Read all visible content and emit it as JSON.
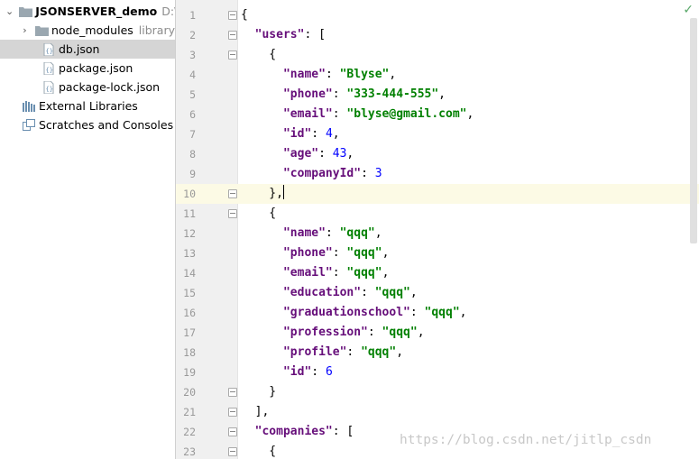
{
  "project_tree": {
    "root": {
      "name": "JSONSERVER_demo",
      "path": "D:\\E"
    },
    "node_modules": {
      "name": "node_modules",
      "tag": "library"
    },
    "files": [
      "db.json",
      "package.json",
      "package-lock.json"
    ],
    "external_libraries": "External Libraries",
    "scratches": "Scratches and Consoles"
  },
  "editor": {
    "status": "ok",
    "lines": [
      [
        {
          "t": "p",
          "v": "{"
        }
      ],
      [
        {
          "t": "p",
          "v": "  "
        },
        {
          "t": "k",
          "v": "\"users\""
        },
        {
          "t": "p",
          "v": ": ["
        }
      ],
      [
        {
          "t": "p",
          "v": "    {"
        }
      ],
      [
        {
          "t": "p",
          "v": "      "
        },
        {
          "t": "k",
          "v": "\"name\""
        },
        {
          "t": "p",
          "v": ": "
        },
        {
          "t": "s",
          "v": "\"Blyse\""
        },
        {
          "t": "p",
          "v": ","
        }
      ],
      [
        {
          "t": "p",
          "v": "      "
        },
        {
          "t": "k",
          "v": "\"phone\""
        },
        {
          "t": "p",
          "v": ": "
        },
        {
          "t": "s",
          "v": "\"333-444-555\""
        },
        {
          "t": "p",
          "v": ","
        }
      ],
      [
        {
          "t": "p",
          "v": "      "
        },
        {
          "t": "k",
          "v": "\"email\""
        },
        {
          "t": "p",
          "v": ": "
        },
        {
          "t": "s",
          "v": "\"blyse@gmail.com\""
        },
        {
          "t": "p",
          "v": ","
        }
      ],
      [
        {
          "t": "p",
          "v": "      "
        },
        {
          "t": "k",
          "v": "\"id\""
        },
        {
          "t": "p",
          "v": ": "
        },
        {
          "t": "n",
          "v": "4"
        },
        {
          "t": "p",
          "v": ","
        }
      ],
      [
        {
          "t": "p",
          "v": "      "
        },
        {
          "t": "k",
          "v": "\"age\""
        },
        {
          "t": "p",
          "v": ": "
        },
        {
          "t": "n",
          "v": "43"
        },
        {
          "t": "p",
          "v": ","
        }
      ],
      [
        {
          "t": "p",
          "v": "      "
        },
        {
          "t": "k",
          "v": "\"companyId\""
        },
        {
          "t": "p",
          "v": ": "
        },
        {
          "t": "n",
          "v": "3"
        }
      ],
      [
        {
          "t": "p",
          "v": "    },"
        }
      ],
      [
        {
          "t": "p",
          "v": "    {"
        }
      ],
      [
        {
          "t": "p",
          "v": "      "
        },
        {
          "t": "k",
          "v": "\"name\""
        },
        {
          "t": "p",
          "v": ": "
        },
        {
          "t": "s",
          "v": "\"qqq\""
        },
        {
          "t": "p",
          "v": ","
        }
      ],
      [
        {
          "t": "p",
          "v": "      "
        },
        {
          "t": "k",
          "v": "\"phone\""
        },
        {
          "t": "p",
          "v": ": "
        },
        {
          "t": "s",
          "v": "\"qqq\""
        },
        {
          "t": "p",
          "v": ","
        }
      ],
      [
        {
          "t": "p",
          "v": "      "
        },
        {
          "t": "k",
          "v": "\"email\""
        },
        {
          "t": "p",
          "v": ": "
        },
        {
          "t": "s",
          "v": "\"qqq\""
        },
        {
          "t": "p",
          "v": ","
        }
      ],
      [
        {
          "t": "p",
          "v": "      "
        },
        {
          "t": "k",
          "v": "\"education\""
        },
        {
          "t": "p",
          "v": ": "
        },
        {
          "t": "s",
          "v": "\"qqq\""
        },
        {
          "t": "p",
          "v": ","
        }
      ],
      [
        {
          "t": "p",
          "v": "      "
        },
        {
          "t": "k",
          "v": "\"graduationschool\""
        },
        {
          "t": "p",
          "v": ": "
        },
        {
          "t": "s",
          "v": "\"qqq\""
        },
        {
          "t": "p",
          "v": ","
        }
      ],
      [
        {
          "t": "p",
          "v": "      "
        },
        {
          "t": "k",
          "v": "\"profession\""
        },
        {
          "t": "p",
          "v": ": "
        },
        {
          "t": "s",
          "v": "\"qqq\""
        },
        {
          "t": "p",
          "v": ","
        }
      ],
      [
        {
          "t": "p",
          "v": "      "
        },
        {
          "t": "k",
          "v": "\"profile\""
        },
        {
          "t": "p",
          "v": ": "
        },
        {
          "t": "s",
          "v": "\"qqq\""
        },
        {
          "t": "p",
          "v": ","
        }
      ],
      [
        {
          "t": "p",
          "v": "      "
        },
        {
          "t": "k",
          "v": "\"id\""
        },
        {
          "t": "p",
          "v": ": "
        },
        {
          "t": "n",
          "v": "6"
        }
      ],
      [
        {
          "t": "p",
          "v": "    }"
        }
      ],
      [
        {
          "t": "p",
          "v": "  ],"
        }
      ],
      [
        {
          "t": "p",
          "v": "  "
        },
        {
          "t": "k",
          "v": "\"companies\""
        },
        {
          "t": "p",
          "v": ": ["
        }
      ],
      [
        {
          "t": "p",
          "v": "    {"
        }
      ]
    ],
    "line_numbers": [
      "1",
      "2",
      "3",
      "4",
      "5",
      "6",
      "7",
      "8",
      "9",
      "10",
      "11",
      "12",
      "13",
      "14",
      "15",
      "16",
      "17",
      "18",
      "19",
      "20",
      "21",
      "22",
      "23"
    ],
    "fold_lines": [
      1,
      2,
      3,
      10,
      11,
      20,
      21,
      22,
      23
    ],
    "current_line": 10,
    "watermark": "https://blog.csdn.net/jitlp_csdn"
  },
  "colors": {
    "key": "#660e7a",
    "string": "#008000",
    "number": "#0000ff",
    "current_line_bg": "#fcfae5",
    "selected_tree_bg": "#d5d5d5"
  }
}
